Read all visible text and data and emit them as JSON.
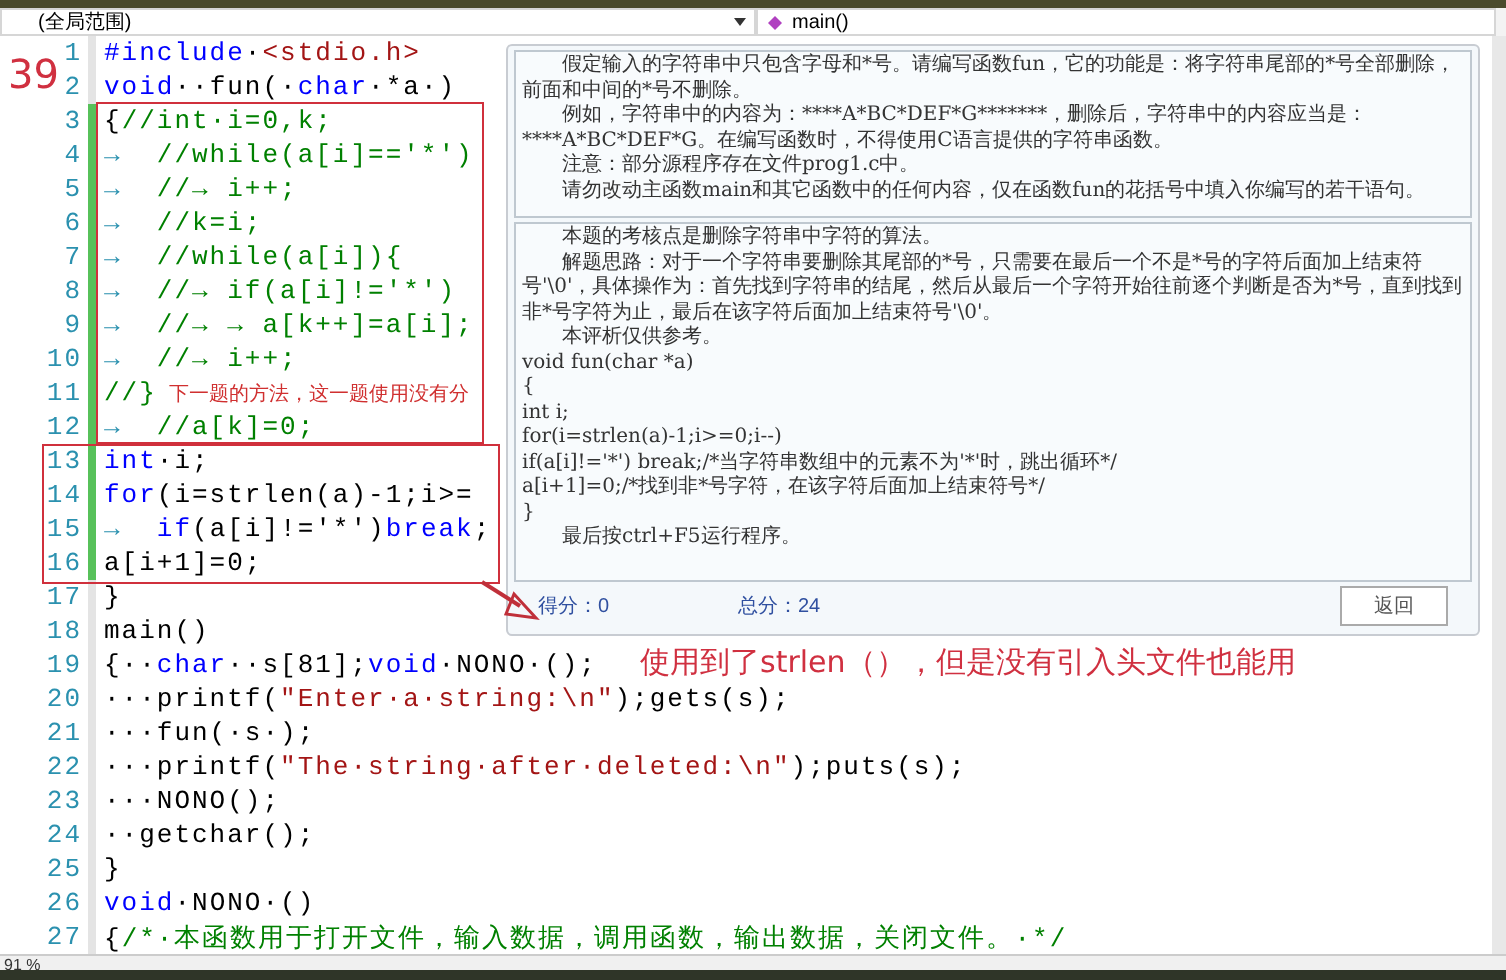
{
  "scope_bar": {
    "scope": "(全局范围)",
    "member": "main()"
  },
  "annotation_number": "39",
  "code_lines": [
    {
      "number": "1",
      "changed": false,
      "tokens": [
        {
          "text": "#include",
          "kind": "keyword"
        },
        {
          "text": "·",
          "kind": "plain"
        },
        {
          "text": "<stdio.h>",
          "kind": "string"
        }
      ]
    },
    {
      "number": "2",
      "changed": false,
      "tokens": [
        {
          "text": "void",
          "kind": "keyword"
        },
        {
          "text": "··fun(·",
          "kind": "plain"
        },
        {
          "text": "char",
          "kind": "keyword"
        },
        {
          "text": "·*a·)",
          "kind": "plain"
        }
      ]
    },
    {
      "number": "3",
      "changed": true,
      "tokens": [
        {
          "text": "{",
          "kind": "plain"
        },
        {
          "text": "//int·i=0,k;",
          "kind": "comment"
        }
      ]
    },
    {
      "number": "4",
      "changed": true,
      "tokens": [
        {
          "text": "→  ",
          "kind": "tab"
        },
        {
          "text": "//while(a[i]=='*')",
          "kind": "comment"
        }
      ]
    },
    {
      "number": "5",
      "changed": true,
      "tokens": [
        {
          "text": "→  ",
          "kind": "tab"
        },
        {
          "text": "//→ i++;",
          "kind": "comment"
        }
      ]
    },
    {
      "number": "6",
      "changed": true,
      "tokens": [
        {
          "text": "→  ",
          "kind": "tab"
        },
        {
          "text": "//k=i;",
          "kind": "comment"
        }
      ]
    },
    {
      "number": "7",
      "changed": true,
      "tokens": [
        {
          "text": "→  ",
          "kind": "tab"
        },
        {
          "text": "//while(a[i]){",
          "kind": "comment"
        }
      ]
    },
    {
      "number": "8",
      "changed": true,
      "tokens": [
        {
          "text": "→  ",
          "kind": "tab"
        },
        {
          "text": "//→ if(a[i]!='*')",
          "kind": "comment"
        }
      ]
    },
    {
      "number": "9",
      "changed": true,
      "tokens": [
        {
          "text": "→  ",
          "kind": "tab"
        },
        {
          "text": "//→ → a[k++]=a[i];",
          "kind": "comment"
        }
      ]
    },
    {
      "number": "10",
      "changed": true,
      "tokens": [
        {
          "text": "→  ",
          "kind": "tab"
        },
        {
          "text": "//→ i++;",
          "kind": "comment"
        }
      ]
    },
    {
      "number": "11",
      "changed": true,
      "tokens": [
        {
          "text": "//}",
          "kind": "comment"
        }
      ],
      "note": "下一题的方法，这一题使用没有分"
    },
    {
      "number": "12",
      "changed": true,
      "tokens": [
        {
          "text": "→  ",
          "kind": "tab"
        },
        {
          "text": "//a[k]=0;",
          "kind": "comment"
        }
      ]
    },
    {
      "number": "13",
      "changed": true,
      "tokens": [
        {
          "text": "int",
          "kind": "keyword"
        },
        {
          "text": "·i;",
          "kind": "plain"
        }
      ]
    },
    {
      "number": "14",
      "changed": true,
      "tokens": [
        {
          "text": "for",
          "kind": "keyword"
        },
        {
          "text": "(i=strlen(a)-1;i>=",
          "kind": "plain"
        }
      ]
    },
    {
      "number": "15",
      "changed": true,
      "tokens": [
        {
          "text": "→  ",
          "kind": "tab"
        },
        {
          "text": "if",
          "kind": "keyword"
        },
        {
          "text": "(a[i]!='*')",
          "kind": "plain"
        },
        {
          "text": "break",
          "kind": "keyword"
        },
        {
          "text": ";",
          "kind": "plain"
        }
      ]
    },
    {
      "number": "16",
      "changed": true,
      "tokens": [
        {
          "text": "a[i+1]=0;",
          "kind": "plain"
        }
      ]
    },
    {
      "number": "17",
      "changed": false,
      "tokens": [
        {
          "text": "}",
          "kind": "plain"
        }
      ]
    },
    {
      "number": "18",
      "changed": false,
      "tokens": [
        {
          "text": "main()",
          "kind": "plain"
        }
      ]
    },
    {
      "number": "19",
      "changed": false,
      "tokens": [
        {
          "text": "{··",
          "kind": "plain"
        },
        {
          "text": "char",
          "kind": "keyword"
        },
        {
          "text": "··s[81];",
          "kind": "plain"
        },
        {
          "text": "void",
          "kind": "keyword"
        },
        {
          "text": "·NONO·();",
          "kind": "plain"
        }
      ]
    },
    {
      "number": "20",
      "changed": false,
      "tokens": [
        {
          "text": "···printf(",
          "kind": "plain"
        },
        {
          "text": "\"Enter·a·string:\\n\"",
          "kind": "string"
        },
        {
          "text": ");gets(s);",
          "kind": "plain"
        }
      ]
    },
    {
      "number": "21",
      "changed": false,
      "tokens": [
        {
          "text": "···fun(·s·);",
          "kind": "plain"
        }
      ]
    },
    {
      "number": "22",
      "changed": false,
      "tokens": [
        {
          "text": "···printf(",
          "kind": "plain"
        },
        {
          "text": "\"The·string·after·deleted:\\n\"",
          "kind": "string"
        },
        {
          "text": ");puts(s);",
          "kind": "plain"
        }
      ]
    },
    {
      "number": "23",
      "changed": false,
      "tokens": [
        {
          "text": "···NONO();",
          "kind": "plain"
        }
      ]
    },
    {
      "number": "24",
      "changed": false,
      "tokens": [
        {
          "text": "··getchar();",
          "kind": "plain"
        }
      ]
    },
    {
      "number": "25",
      "changed": false,
      "tokens": [
        {
          "text": "}",
          "kind": "plain"
        }
      ]
    },
    {
      "number": "26",
      "changed": false,
      "tokens": [
        {
          "text": "void",
          "kind": "keyword"
        },
        {
          "text": "·NONO·()",
          "kind": "plain"
        }
      ]
    },
    {
      "number": "27",
      "changed": false,
      "tokens": [
        {
          "text": "{",
          "kind": "plain"
        },
        {
          "text": "/*·本函数用于打开文件，输入数据，调用函数，输出数据，关闭文件。·*/",
          "kind": "comment"
        }
      ]
    }
  ],
  "question_panel": {
    "question": [
      "假定输入的字符串中只包含字母和*号。请编写函数fun，它的功能是：将字符串尾部的*号全部删除，前面和中间的*号不删除。",
      "例如，字符串中的内容为：****A*BC*DEF*G*******，删除后，字符串中的内容应当是：****A*BC*DEF*G。在编写函数时，不得使用C语言提供的字符串函数。",
      "注意：部分源程序存在文件prog1.c中。",
      "请勿改动主函数main和其它函数中的任何内容，仅在函数fun的花括号中填入你编写的若干语句。"
    ],
    "analysis": [
      {
        "text": "本题的考核点是删除字符串中字符的算法。",
        "kind": "para"
      },
      {
        "text": "解题思路：对于一个字符串要删除其尾部的*号，只需要在最后一个不是*号的字符后面加上结束符号'\\0'，具体操作为：首先找到字符串的结尾，然后从最后一个字符开始往前逐个判断是否为*号，直到找到非*号字符为止，最后在该字符后面加上结束符号'\\0'。",
        "kind": "para"
      },
      {
        "text": "本评析仅供参考。",
        "kind": "para"
      },
      {
        "text": "void fun(char *a)",
        "kind": "code"
      },
      {
        "text": "{",
        "kind": "code"
      },
      {
        "text": "int i;",
        "kind": "code"
      },
      {
        "text": "for(i=strlen(a)-1;i>=0;i--)",
        "kind": "code"
      },
      {
        "text": "if(a[i]!='*') break;/*当字符串数组中的元素不为'*'时，跳出循环*/",
        "kind": "code"
      },
      {
        "text": "a[i+1]=0;/*找到非*号字符，在该字符后面加上结束符号*/",
        "kind": "code"
      },
      {
        "text": "}",
        "kind": "code"
      },
      {
        "text": "最后按ctrl+F5运行程序。",
        "kind": "para"
      }
    ],
    "score": "得分：0",
    "total": "总分：24",
    "back_button": "返回"
  },
  "handwritten_note": "使用到了strlen（），但是没有引入头文件也能用",
  "status_bar": {
    "zoom": "91 %"
  }
}
